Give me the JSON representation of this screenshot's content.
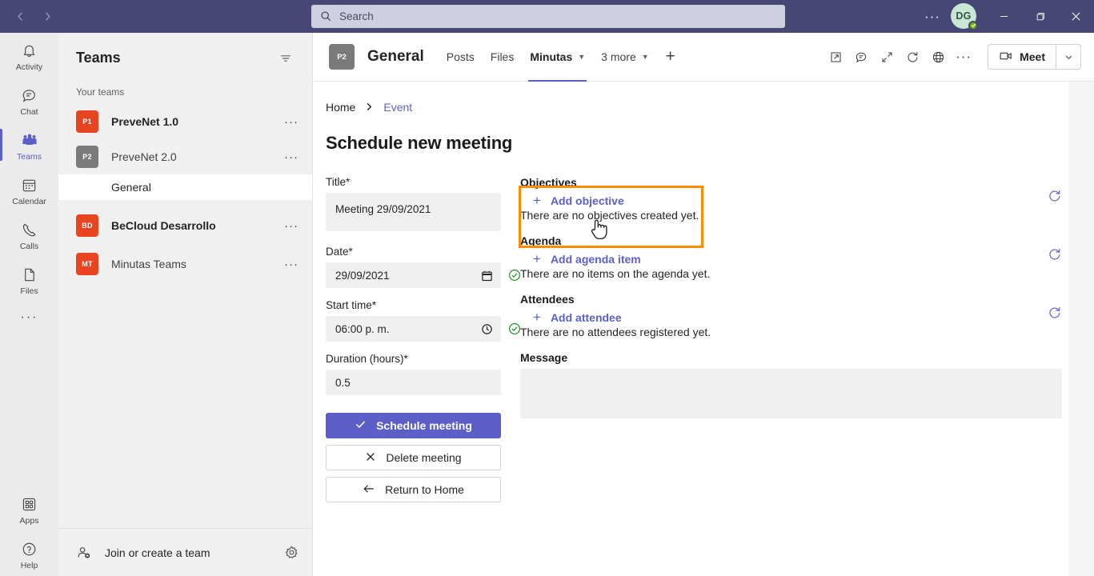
{
  "titlebar": {
    "back_icon": "chevron-left-icon",
    "forward_icon": "chevron-right-icon",
    "search_placeholder": "Search",
    "more_label": "···",
    "avatar_initials": "DG",
    "presence_status": "available",
    "minimize_label": "—",
    "maximize_label": "❐",
    "close_label": "✕",
    "bg_color": "#464775"
  },
  "rail": {
    "items": [
      {
        "label": "Activity",
        "icon": "bell-icon",
        "active": false
      },
      {
        "label": "Chat",
        "icon": "chat-icon",
        "active": false
      },
      {
        "label": "Teams",
        "icon": "teams-icon",
        "active": true
      },
      {
        "label": "Calendar",
        "icon": "calendar-icon",
        "active": false
      },
      {
        "label": "Calls",
        "icon": "phone-icon",
        "active": false
      },
      {
        "label": "Files",
        "icon": "file-icon",
        "active": false
      }
    ],
    "more_label": "···",
    "bottom": [
      {
        "label": "Apps",
        "icon": "apps-grid-icon"
      },
      {
        "label": "Help",
        "icon": "question-circle-icon"
      }
    ],
    "accent_color": "#5b5fc7"
  },
  "sidebar": {
    "title": "Teams",
    "filter_icon": "filter-icon",
    "section_label": "Your teams",
    "teams": [
      {
        "initials": "P1",
        "name": "PreveNet 1.0",
        "color": "#e8441f",
        "bold": true,
        "more": "···"
      },
      {
        "initials": "P2",
        "name": "PreveNet 2.0",
        "color": "#7a7a7a",
        "bold": false,
        "more": "···"
      },
      {
        "initials": "BD",
        "name": "BeCloud Desarrollo",
        "color": "#e8441f",
        "bold": true,
        "more": "···"
      },
      {
        "initials": "MT",
        "name": "Minutas Teams",
        "color": "#e8441f",
        "bold": false,
        "more": "···"
      }
    ],
    "selected_channel": "General",
    "footer_label": "Join or create a team",
    "footer_icon": "add-person-icon",
    "footer_gear_icon": "gear-icon"
  },
  "channel_header": {
    "avatar_initials": "P2",
    "channel_name": "General",
    "tabs": [
      {
        "label": "Posts",
        "active": false,
        "caret": false
      },
      {
        "label": "Files",
        "active": false,
        "caret": false
      },
      {
        "label": "Minutas",
        "active": true,
        "caret": true
      },
      {
        "label": "3 more",
        "active": false,
        "caret": true
      }
    ],
    "add_tab_label": "+",
    "action_icons": [
      "open-in-new-icon",
      "chat-bubble-icon",
      "expand-arrows-icon",
      "refresh-icon",
      "globe-icon",
      "more-options-icon"
    ],
    "meet_label": "Meet",
    "meet_icon": "video-camera-icon",
    "meet_caret_icon": "chevron-down-icon"
  },
  "app": {
    "breadcrumb": {
      "home": "Home",
      "separator": "›",
      "current": "Event"
    },
    "page_title": "Schedule new meeting",
    "form": {
      "title_label": "Title*",
      "title_value": "Meeting  29/09/2021",
      "date_label": "Date*",
      "date_value": "29/09/2021",
      "date_icon": "calendar-picker-icon",
      "date_valid_icon": "check-circle-icon",
      "start_time_label": "Start time*",
      "start_time_value": "06:00 p. m.",
      "time_icon": "clock-icon",
      "time_valid_icon": "check-circle-icon",
      "duration_label": "Duration (hours)*",
      "duration_value": "0.5",
      "valid_color": "#0e8a0e"
    },
    "buttons": {
      "schedule": {
        "label": "Schedule meeting",
        "icon": "check-icon"
      },
      "delete": {
        "label": "Delete meeting",
        "icon": "x-icon"
      },
      "return": {
        "label": "Return to Home",
        "icon": "arrow-left-icon"
      }
    },
    "sections": [
      {
        "title": "Objectives",
        "add_label": "Add objective",
        "add_icon": "plus-icon",
        "empty_text": "There are no objectives created yet.",
        "refresh_icon": "refresh-icon",
        "highlighted": true
      },
      {
        "title": "Agenda",
        "add_label": "Add agenda item",
        "add_icon": "plus-icon",
        "empty_text": "There are no items on the agenda yet.",
        "refresh_icon": "refresh-icon",
        "highlighted": false
      },
      {
        "title": "Attendees",
        "add_label": "Add attendee",
        "add_icon": "plus-icon",
        "empty_text": "There are no attendees registered yet.",
        "refresh_icon": "refresh-icon",
        "highlighted": false
      }
    ],
    "message_label": "Message",
    "message_value": "",
    "link_color": "#5b5fc7",
    "highlight_color": "#ff8c00"
  }
}
